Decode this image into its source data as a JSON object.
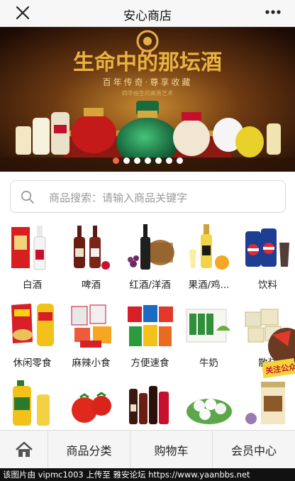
{
  "header": {
    "title": "安心商店",
    "close_icon": "close-icon",
    "more_icon": "more-icon"
  },
  "banner": {
    "headline": "生命中的那坛酒",
    "slogan": "百年传奇·尊享收藏",
    "subtext": "四华由生的高贵艺术",
    "slide_count": 7,
    "active_slide": 1,
    "colors": {
      "active_dot": "#f06b3b",
      "dot": "#ffffff",
      "headline": "#e8b341"
    }
  },
  "search": {
    "placeholder": "商品搜索：请输入商品关键字",
    "icon": "search-icon"
  },
  "categories": [
    {
      "label": "白酒"
    },
    {
      "label": "啤酒"
    },
    {
      "label": "红酒/洋酒"
    },
    {
      "label": "果酒/鸡..."
    },
    {
      "label": "饮料"
    },
    {
      "label": "休闲零食"
    },
    {
      "label": "麻辣小食"
    },
    {
      "label": "方便速食"
    },
    {
      "label": "牛奶"
    },
    {
      "label": "散装"
    },
    {
      "label": ""
    },
    {
      "label": ""
    },
    {
      "label": ""
    },
    {
      "label": ""
    },
    {
      "label": ""
    }
  ],
  "sticker": {
    "text": "关注公众"
  },
  "tabbar": {
    "home_icon": "home-icon",
    "category_label": "商品分类",
    "cart_label": "购物车",
    "member_label": "会员中心"
  },
  "footer": {
    "text": "该图片由 vipmc1003 上传至 雅安论坛 https://www.yaanbbs.net"
  }
}
